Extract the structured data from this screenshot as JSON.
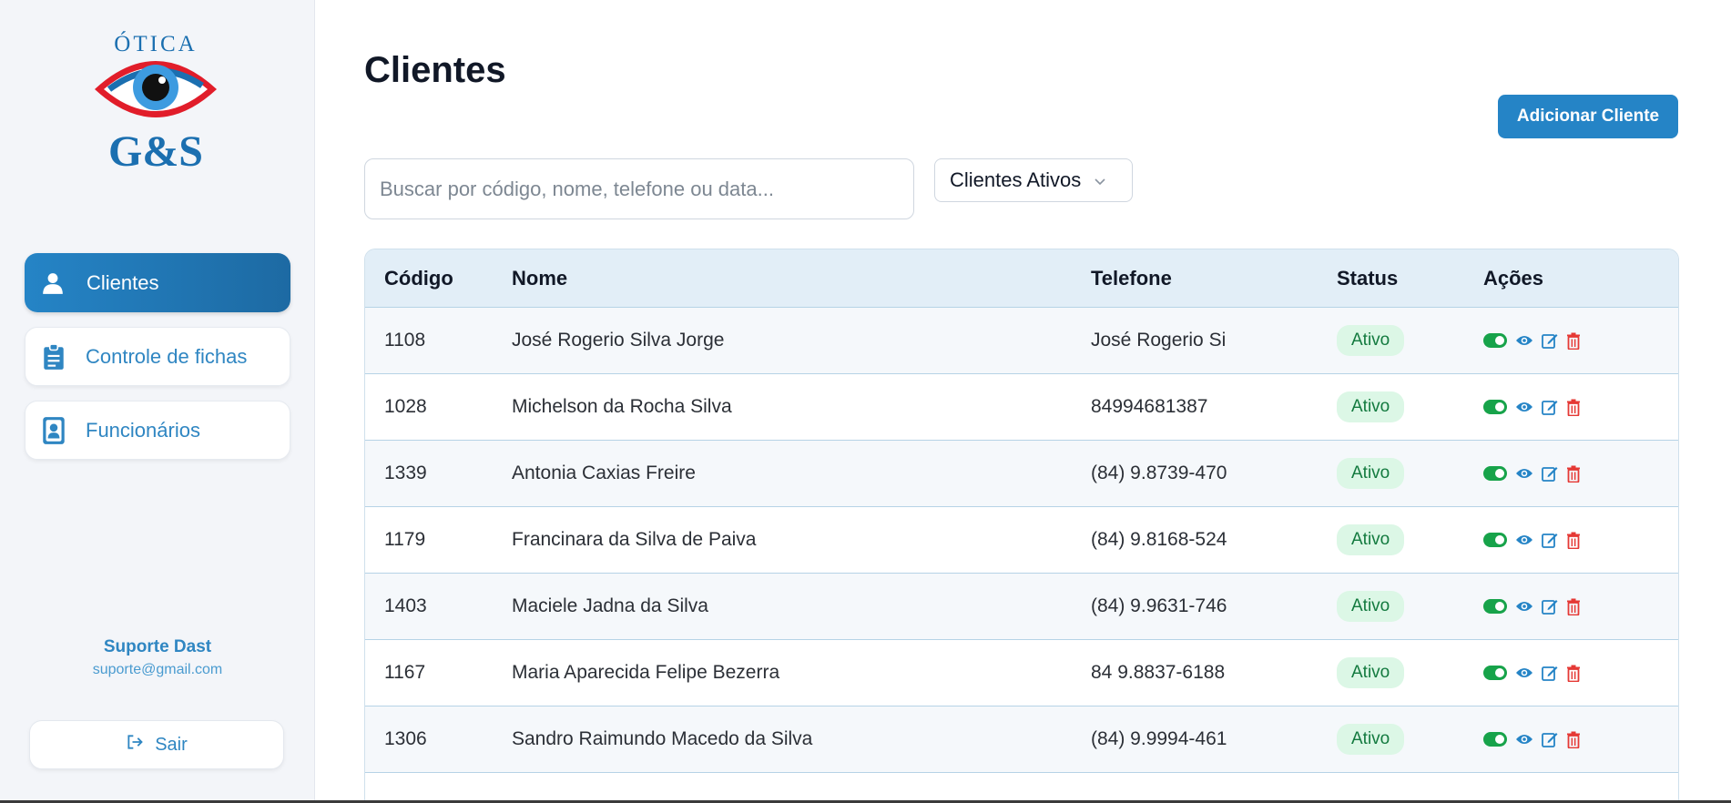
{
  "sidebar": {
    "logo_top": "ÓTICA",
    "logo_bottom": "G&S",
    "items": [
      {
        "label": "Clientes",
        "icon": "user-icon"
      },
      {
        "label": "Controle de fichas",
        "icon": "clipboard-icon"
      },
      {
        "label": "Funcionários",
        "icon": "badge-icon"
      }
    ],
    "user_name": "Suporte Dast",
    "user_email": "suporte@gmail.com",
    "logout_label": "Sair"
  },
  "main": {
    "title": "Clientes",
    "add_button": "Adicionar Cliente",
    "search_placeholder": "Buscar por código, nome, telefone ou data...",
    "filter_value": "Clientes Ativos"
  },
  "table": {
    "headers": [
      "Código",
      "Nome",
      "Telefone",
      "Status",
      "Ações"
    ],
    "rows": [
      {
        "code": "1108",
        "name": "José Rogerio Silva Jorge",
        "phone": "José Rogerio Si",
        "status": "Ativo"
      },
      {
        "code": "1028",
        "name": "Michelson da Rocha Silva",
        "phone": "84994681387",
        "status": "Ativo"
      },
      {
        "code": "1339",
        "name": "Antonia Caxias Freire",
        "phone": "(84) 9.8739-470",
        "status": "Ativo"
      },
      {
        "code": "1179",
        "name": "Francinara da Silva de Paiva",
        "phone": "(84) 9.8168-524",
        "status": "Ativo"
      },
      {
        "code": "1403",
        "name": "Maciele Jadna da Silva",
        "phone": "(84) 9.9631-746",
        "status": "Ativo"
      },
      {
        "code": "1167",
        "name": "Maria Aparecida Felipe Bezerra",
        "phone": "84 9.8837-6188",
        "status": "Ativo"
      },
      {
        "code": "1306",
        "name": "Sandro Raimundo Macedo da Silva",
        "phone": "(84) 9.9994-461",
        "status": "Ativo"
      }
    ]
  },
  "colors": {
    "accent": "#2584c6",
    "active_green": "#17a34a",
    "delete_red": "#e53935",
    "status_bg": "#dcf7e6"
  }
}
